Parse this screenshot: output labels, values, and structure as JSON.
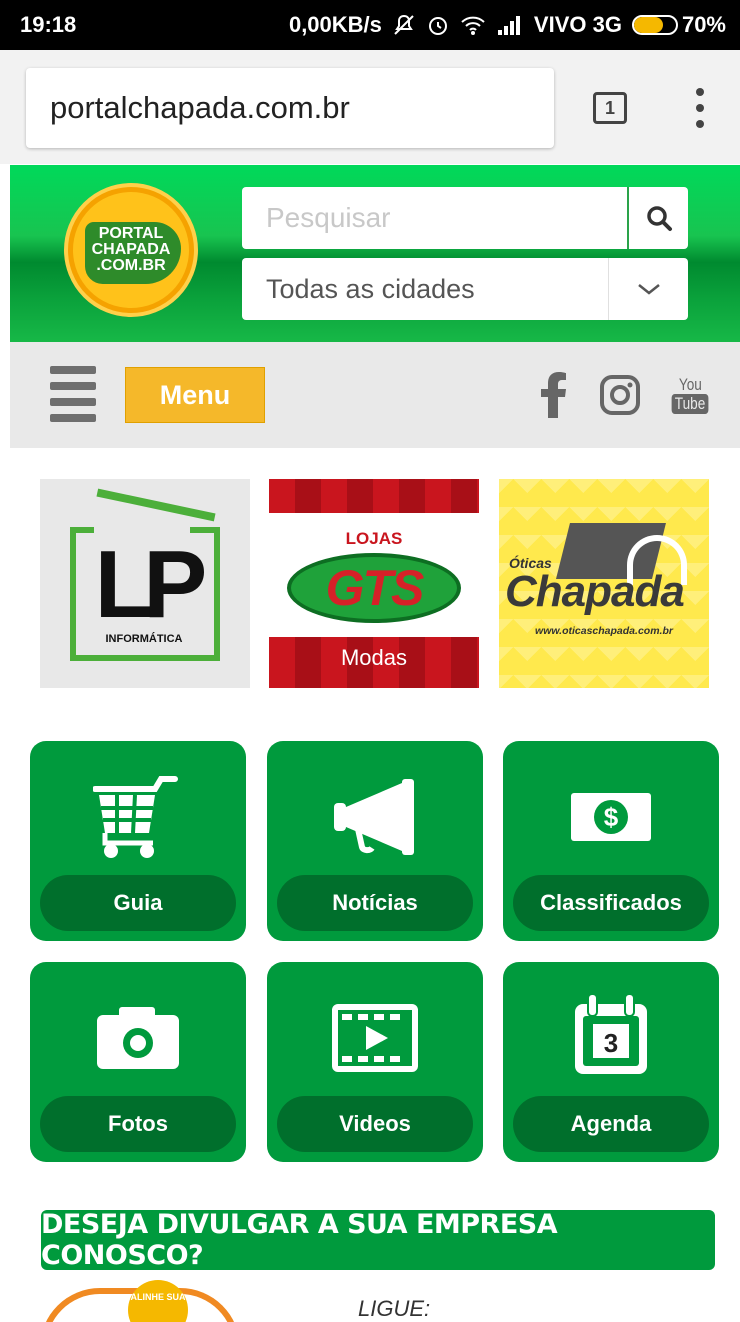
{
  "status_bar": {
    "time": "19:18",
    "net_speed": "0,00KB/s",
    "carrier": "VIVO 3G",
    "battery": "70%",
    "battery_level": 0.7
  },
  "browser": {
    "url": "portalchapada.com.br",
    "tab_count": "1"
  },
  "header": {
    "logo_line1": "PORTAL",
    "logo_line2": "CHAPADA",
    "logo_line3": ".COM.BR",
    "search_placeholder": "Pesquisar",
    "city_select": "Todas as cidades"
  },
  "menubar": {
    "menu_label": "Menu",
    "youtube_top": "You",
    "youtube_bottom": "Tube"
  },
  "banners": {
    "lp": {
      "brand": "LP",
      "sub": "INFORMÁTICA"
    },
    "gts": {
      "top": "LOJAS",
      "brand": "GTS",
      "bottom": "Modas"
    },
    "oticas": {
      "top": "Óticas",
      "brand": "Chapada",
      "url": "www.oticaschapada.com.br"
    }
  },
  "tiles": [
    {
      "label": "Guia",
      "icon": "cart-icon"
    },
    {
      "label": "Notícias",
      "icon": "megaphone-icon"
    },
    {
      "label": "Classificados",
      "icon": "money-icon"
    },
    {
      "label": "Fotos",
      "icon": "camera-icon"
    },
    {
      "label": "Videos",
      "icon": "film-icon"
    },
    {
      "label": "Agenda",
      "icon": "calendar-icon",
      "calendar_day": "3"
    }
  ],
  "promo": {
    "title": "DESEJA DIVULGAR A SUA EMPRESA CONOSCO?",
    "call": "LIGUE:",
    "seal": "ALINHE SUA"
  },
  "colors": {
    "green": "#009a3d",
    "dark_green": "#006f2c",
    "menu_yellow": "#f5b82a"
  }
}
